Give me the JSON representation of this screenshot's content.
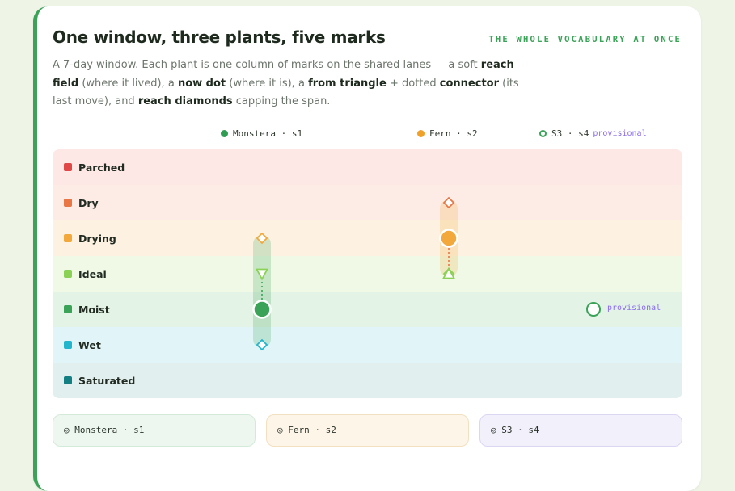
{
  "header": {
    "title": "One window, three plants, five marks",
    "kicker": "THE WHOLE VOCABULARY AT ONCE"
  },
  "description": {
    "p1": "A 7-day window. Each plant is one column of marks on the shared lanes — a soft ",
    "reach_field": "reach field",
    "p2": " (where it lived), a ",
    "now_dot": "now dot",
    "p3": " (where it is), a ",
    "from_triangle": "from triangle",
    "p4": " + dotted ",
    "connector": "connector",
    "p5": " (its last move), and ",
    "reach_diamonds": "reach diamonds",
    "p6": " capping the span."
  },
  "legend": [
    {
      "label": "Monstera · s1",
      "color": "#2f9e52",
      "hollow": false,
      "tag": ""
    },
    {
      "label": "Fern · s2",
      "color": "#f0a12a",
      "hollow": false,
      "tag": ""
    },
    {
      "label": "S3 · s4",
      "color": "#3aa357",
      "hollow": true,
      "tag": "provisional"
    }
  ],
  "lanes": [
    {
      "name": "Parched",
      "swatch": "#e04848",
      "bg": "#fde8e6"
    },
    {
      "name": "Dry",
      "swatch": "#e97645",
      "bg": "#fdece5"
    },
    {
      "name": "Drying",
      "swatch": "#f2a83a",
      "bg": "#fdf2e2"
    },
    {
      "name": "Ideal",
      "swatch": "#8bd156",
      "bg": "#eff9e6"
    },
    {
      "name": "Moist",
      "swatch": "#3aa357",
      "bg": "#e3f3e6"
    },
    {
      "name": "Wet",
      "swatch": "#21b6cc",
      "bg": "#e1f5f8"
    },
    {
      "name": "Saturated",
      "swatch": "#137f82",
      "bg": "#e1efee"
    }
  ],
  "plants": [
    {
      "name": "Monstera",
      "reach_from": "Drying",
      "reach_to": "Wet",
      "now": "Moist",
      "from": "Ideal",
      "provisional": false
    },
    {
      "name": "Fern",
      "reach_from": "Dry",
      "reach_to": "Ideal",
      "now": "Drying",
      "from": "Ideal",
      "provisional": false
    },
    {
      "name": "S3",
      "now": "Moist",
      "provisional": true,
      "tag": "provisional"
    }
  ],
  "details": [
    {
      "label": "Monstera · s1",
      "bg": "#eef7ef",
      "border": "#d3ead8"
    },
    {
      "label": "Fern · s2",
      "bg": "#fdf5e8",
      "border": "#f3e0c0"
    },
    {
      "label": "S3 · s4",
      "bg": "#f2f0fb",
      "border": "#dcd6f2"
    }
  ],
  "icons": {
    "detail": "eye-icon"
  }
}
